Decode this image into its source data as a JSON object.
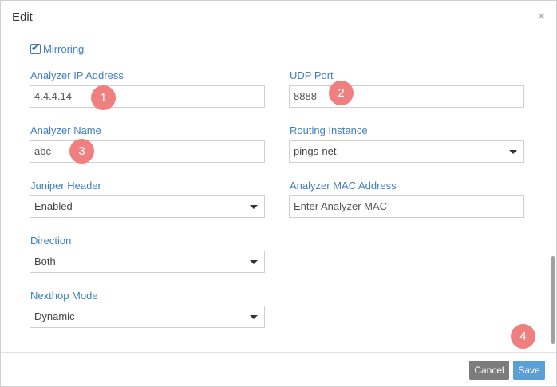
{
  "dialog": {
    "title": "Edit",
    "close_glyph": "×"
  },
  "mirroring": {
    "label": "Mirroring",
    "checked": true
  },
  "fields": {
    "analyzer_ip": {
      "label": "Analyzer IP Address",
      "value": "4.4.4.14"
    },
    "udp_port": {
      "label": "UDP Port",
      "value": "8888"
    },
    "analyzer_name": {
      "label": "Analyzer Name",
      "value": "abc"
    },
    "routing_instance": {
      "label": "Routing Instance",
      "value": "pings-net"
    },
    "juniper_header": {
      "label": "Juniper Header",
      "value": "Enabled"
    },
    "analyzer_mac": {
      "label": "Analyzer MAC Address",
      "placeholder": "Enter Analyzer MAC"
    },
    "direction": {
      "label": "Direction",
      "value": "Both"
    },
    "nexthop_mode": {
      "label": "Nexthop Mode",
      "value": "Dynamic"
    }
  },
  "badges": [
    "1",
    "2",
    "3",
    "4"
  ],
  "footer": {
    "cancel_label": "Cancel",
    "save_label": "Save"
  },
  "colors": {
    "label_blue": "#3e7fc0",
    "badge": "#f07f80",
    "cancel": "#7c7c7c",
    "save": "#5aa0d6"
  },
  "icons": {
    "close": "close-icon",
    "checkbox": "checkmark-icon",
    "dropdown": "caret-down-icon"
  }
}
